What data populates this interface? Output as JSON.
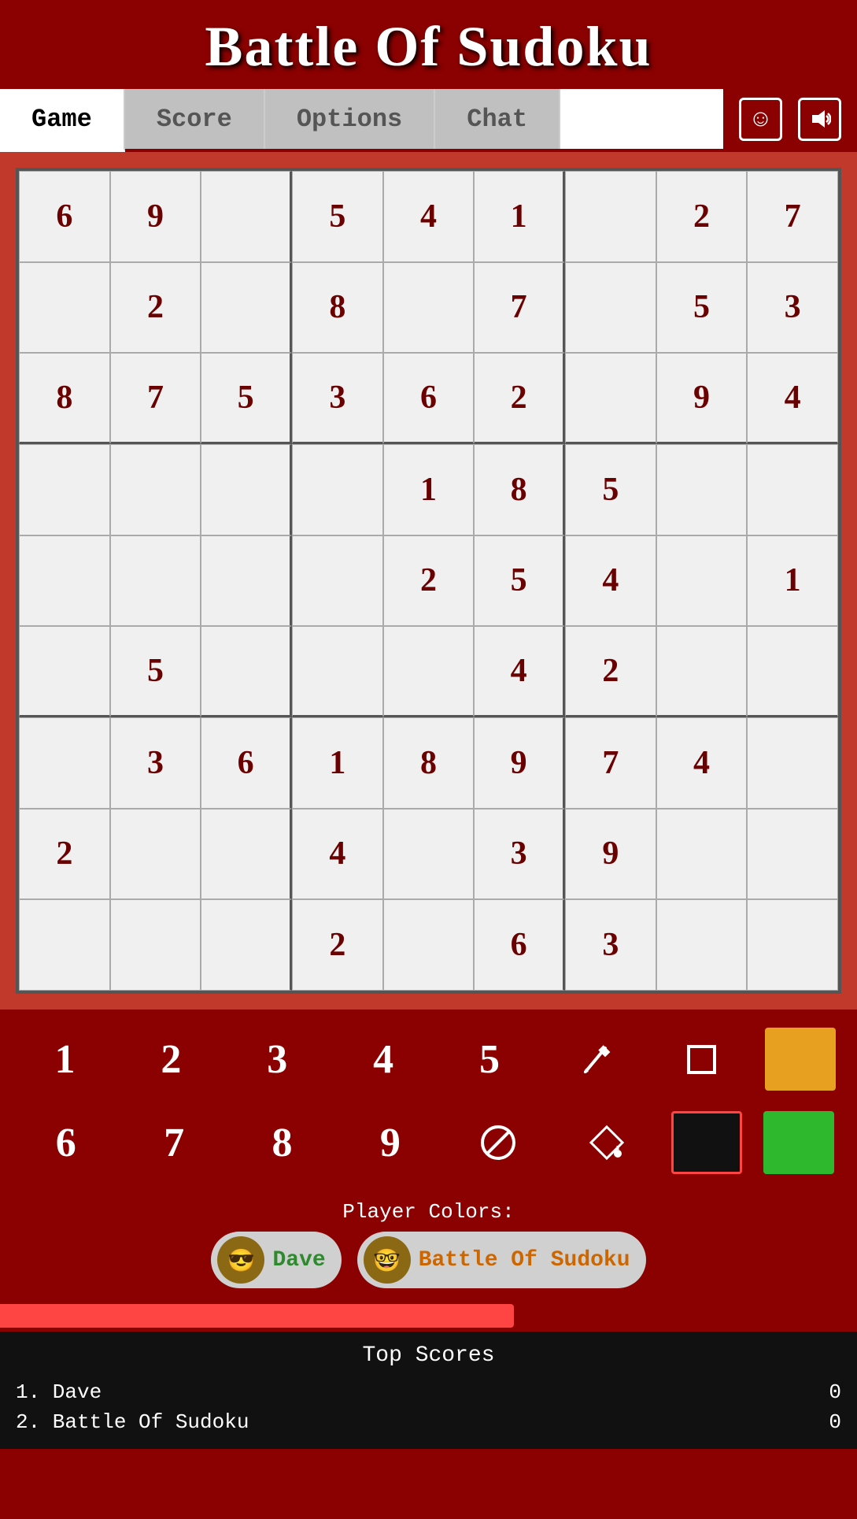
{
  "header": {
    "title": "Battle Of Sudoku"
  },
  "nav": {
    "tabs": [
      {
        "label": "Game",
        "active": true
      },
      {
        "label": "Score",
        "active": false
      },
      {
        "label": "Options",
        "active": false
      },
      {
        "label": "Chat",
        "active": false
      }
    ],
    "emoji_icon": "☺",
    "sound_icon": "🔊"
  },
  "grid": {
    "cells": [
      "6",
      "9",
      "",
      "5",
      "4",
      "1",
      "",
      "2",
      "7",
      "",
      "2",
      "",
      "8",
      "",
      "7",
      "",
      "5",
      "3",
      "8",
      "7",
      "5",
      "3",
      "6",
      "2",
      "",
      "9",
      "4",
      "",
      "",
      "",
      "",
      "1",
      "8",
      "5",
      "",
      "",
      "",
      "",
      "",
      "",
      "2",
      "5",
      "4",
      "",
      "1",
      "",
      "5",
      "",
      "",
      "",
      "4",
      "2",
      "",
      "",
      "",
      "3",
      "6",
      "1",
      "8",
      "9",
      "7",
      "4",
      "",
      "2",
      "",
      "",
      "4",
      "",
      "3",
      "9",
      "",
      "",
      "",
      "",
      "",
      "2",
      "",
      "6",
      "3",
      "",
      ""
    ]
  },
  "numpad": {
    "row1": [
      {
        "type": "number",
        "value": "1"
      },
      {
        "type": "number",
        "value": "2"
      },
      {
        "type": "number",
        "value": "3"
      },
      {
        "type": "number",
        "value": "4"
      },
      {
        "type": "number",
        "value": "5"
      },
      {
        "type": "icon",
        "value": "pencil",
        "label": "✏"
      },
      {
        "type": "icon",
        "value": "square",
        "label": "□"
      },
      {
        "type": "color",
        "value": "#e8a020"
      }
    ],
    "row2": [
      {
        "type": "number",
        "value": "6"
      },
      {
        "type": "number",
        "value": "7"
      },
      {
        "type": "number",
        "value": "8"
      },
      {
        "type": "number",
        "value": "9"
      },
      {
        "type": "icon",
        "value": "erase",
        "label": "⊘"
      },
      {
        "type": "icon",
        "value": "fill",
        "label": "◇"
      },
      {
        "type": "color",
        "value": "#111111"
      },
      {
        "type": "color",
        "value": "#2db82d"
      }
    ]
  },
  "player_colors": {
    "label": "Player Colors:",
    "players": [
      {
        "name": "Dave",
        "color": "green",
        "avatar": "😎"
      },
      {
        "name": "Battle Of Sudoku",
        "color": "orange",
        "avatar": "🤓"
      }
    ]
  },
  "score_bar": {
    "fill_percent": 60
  },
  "top_scores": {
    "title": "Top Scores",
    "rows": [
      {
        "rank": "1.",
        "name": "Dave",
        "score": "0"
      },
      {
        "rank": "2.",
        "name": "Battle Of Sudoku",
        "score": "0"
      }
    ]
  }
}
